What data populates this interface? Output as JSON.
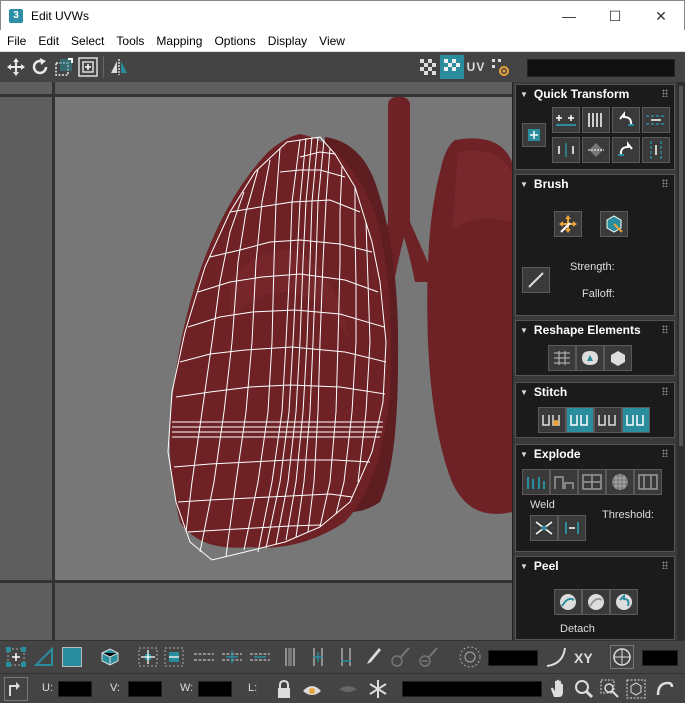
{
  "window": {
    "title": "Edit UVWs",
    "app_icon": "3",
    "minimize_icon": "—",
    "maximize_icon": "☐",
    "close_icon": "✕"
  },
  "menu": [
    "File",
    "Edit",
    "Select",
    "Tools",
    "Mapping",
    "Options",
    "Display",
    "View"
  ],
  "toolbar": {
    "uv_label": "UV"
  },
  "panel": {
    "quick_transform": "Quick Transform",
    "brush": "Brush",
    "strength_label": "Strength:",
    "falloff_label": "Falloff:",
    "reshape": "Reshape Elements",
    "stitch": "Stitch",
    "explode": "Explode",
    "weld_label": "Weld",
    "threshold_label": "Threshold:",
    "peel": "Peel",
    "detach_label": "Detach"
  },
  "bottom": {
    "xy_label": "XY",
    "u_label": "U:",
    "v_label": "V:",
    "w_label": "W:",
    "l_label": "L:"
  },
  "colors": {
    "accent": "#2a8d9d",
    "lung": "#6e2226",
    "mesh": "#ffffff"
  }
}
